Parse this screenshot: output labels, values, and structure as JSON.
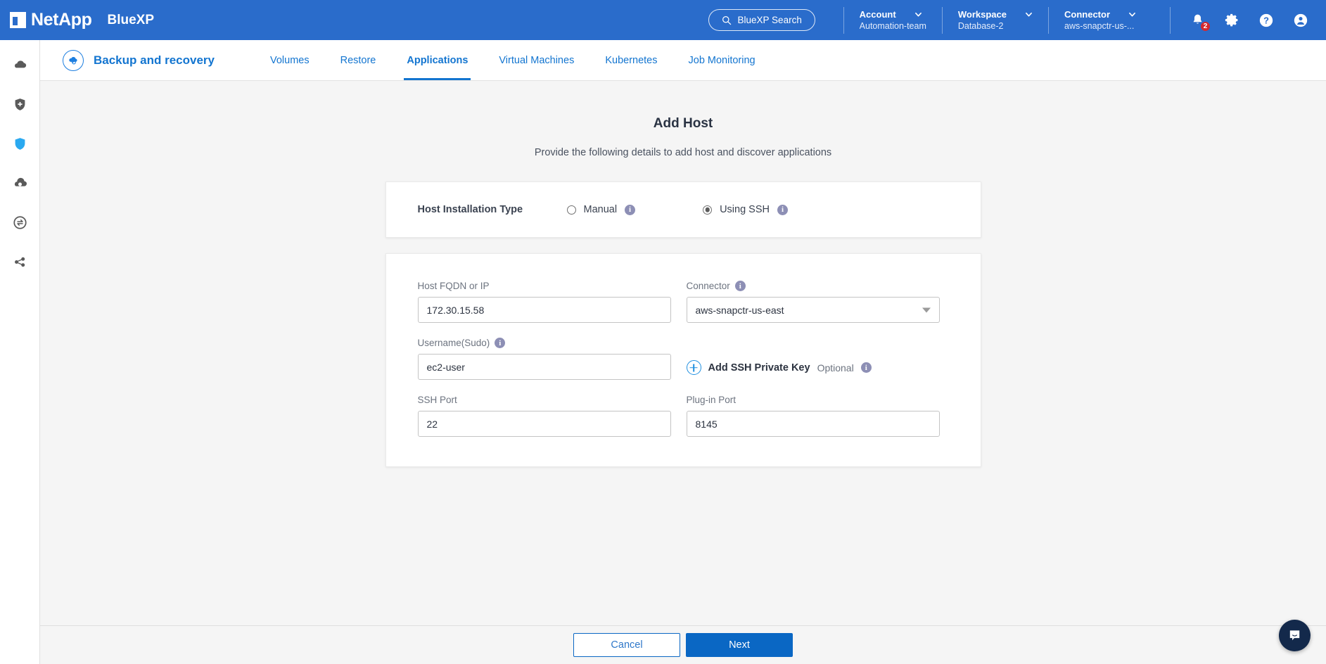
{
  "topbar": {
    "brand_netapp": "NetApp",
    "brand_product": "BlueXP",
    "search_label": "BlueXP Search",
    "menus": [
      {
        "title": "Account",
        "value": "Automation-team"
      },
      {
        "title": "Workspace",
        "value": "Database-2"
      },
      {
        "title": "Connector",
        "value": "aws-snapctr-us-..."
      }
    ],
    "notification_count": "2",
    "icons": [
      "bell-icon",
      "gear-icon",
      "help-icon",
      "user-avatar-icon"
    ],
    "background_color": "#2a6ccb"
  },
  "sidebar": {
    "items": [
      {
        "name": "canvas-icon",
        "active": false
      },
      {
        "name": "health-icon",
        "active": false
      },
      {
        "name": "protection-icon",
        "active": true
      },
      {
        "name": "mobility-icon",
        "active": false
      },
      {
        "name": "governance-icon",
        "active": false
      },
      {
        "name": "extensions-icon",
        "active": false
      }
    ],
    "active_color": "#1f9cf0"
  },
  "service_header": {
    "title": "Backup and recovery",
    "accent_color": "#1375d0",
    "tabs": [
      {
        "label": "Volumes",
        "active": false
      },
      {
        "label": "Restore",
        "active": false
      },
      {
        "label": "Applications",
        "active": true
      },
      {
        "label": "Virtual Machines",
        "active": false
      },
      {
        "label": "Kubernetes",
        "active": false
      },
      {
        "label": "Job Monitoring",
        "active": false
      }
    ]
  },
  "main": {
    "title": "Add Host",
    "subtitle": "Provide the following details to add host and discover applications",
    "installation": {
      "label": "Host Installation Type",
      "options": [
        {
          "label": "Manual",
          "selected": false,
          "info": "i"
        },
        {
          "label": "Using SSH",
          "selected": true,
          "info": "i"
        }
      ]
    },
    "fields": {
      "host_fqdn": {
        "label": "Host FQDN or IP",
        "value": "172.30.15.58",
        "placeholder": "Host FQDN or IP",
        "has_info": false
      },
      "connector": {
        "label": "Connector",
        "value": "aws-snapctr-us-east",
        "has_info": true
      },
      "username": {
        "label": "Username(Sudo)",
        "value": "ec2-user",
        "placeholder": "Username(Sudo)",
        "has_info": true
      },
      "ssh_port": {
        "label": "SSH Port",
        "value": "22",
        "placeholder": "SSH Port",
        "has_info": false
      },
      "plugin_port": {
        "label": "Plug-in Port",
        "value": "8145",
        "placeholder": "Plug-in Port",
        "has_info": false
      }
    },
    "add_ssh_key": {
      "text": "Add SSH Private Key",
      "optional": "Optional",
      "info": "i"
    }
  },
  "footer": {
    "cancel_label": "Cancel",
    "next_label": "Next",
    "primary_color": "#0a67c4"
  },
  "chat": {
    "name": "chat-widget",
    "color": "#13294b"
  }
}
